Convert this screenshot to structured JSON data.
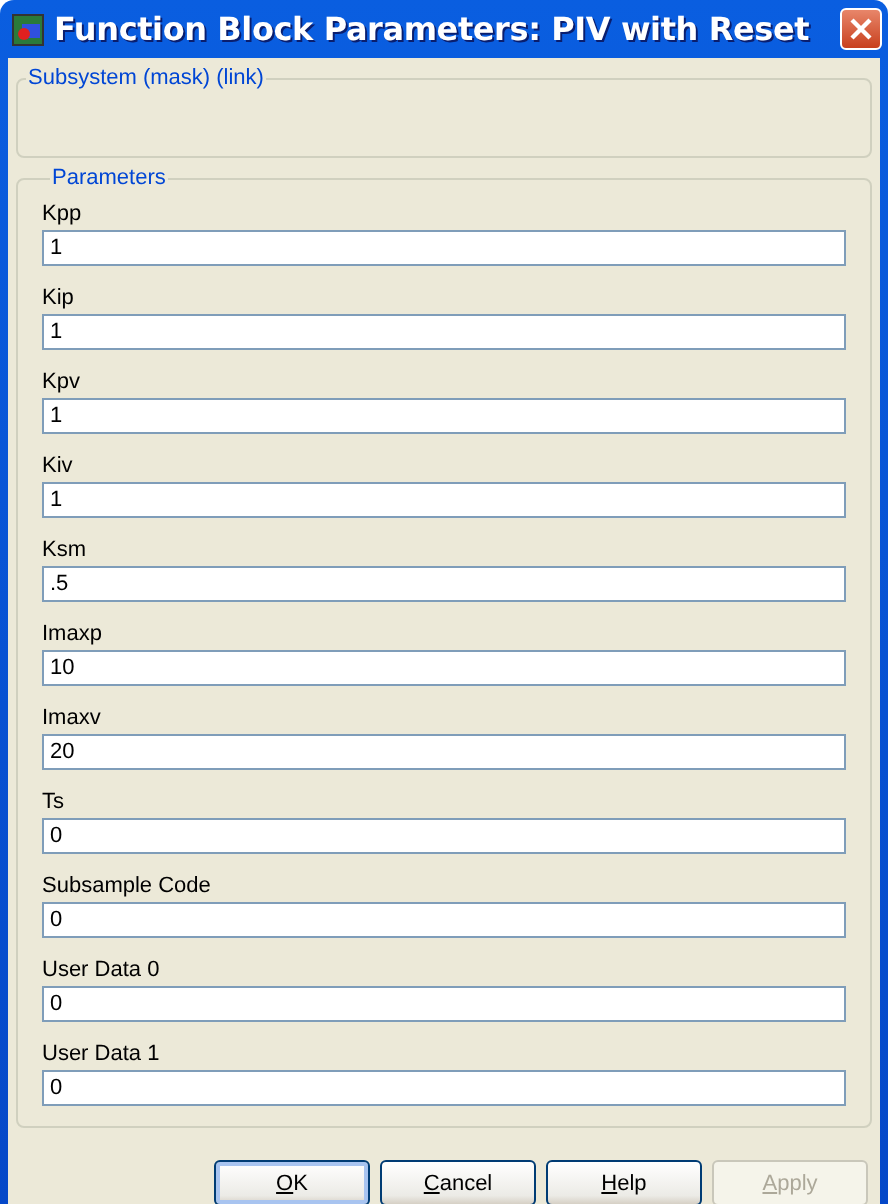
{
  "window": {
    "title": "Function Block Parameters: PIV with Reset"
  },
  "description_group": {
    "title": "Subsystem (mask) (link)"
  },
  "parameters_group": {
    "title": "Parameters"
  },
  "parameters": [
    {
      "label": "Kpp",
      "value": "1"
    },
    {
      "label": "Kip",
      "value": "1"
    },
    {
      "label": "Kpv",
      "value": "1"
    },
    {
      "label": "Kiv",
      "value": "1"
    },
    {
      "label": "Ksm",
      "value": ".5"
    },
    {
      "label": "Imaxp",
      "value": "10"
    },
    {
      "label": "Imaxv",
      "value": "20"
    },
    {
      "label": "Ts",
      "value": "0"
    },
    {
      "label": "Subsample Code",
      "value": "0"
    },
    {
      "label": "User Data 0",
      "value": "0"
    },
    {
      "label": "User Data 1",
      "value": "0"
    }
  ],
  "buttons": [
    {
      "label": "OK",
      "default": true,
      "disabled": false,
      "underline_first": true
    },
    {
      "label": "Cancel",
      "default": false,
      "disabled": false,
      "underline_first": true
    },
    {
      "label": "Help",
      "default": false,
      "disabled": false,
      "underline_first": true
    },
    {
      "label": "Apply",
      "default": false,
      "disabled": true,
      "underline_first": true
    }
  ]
}
